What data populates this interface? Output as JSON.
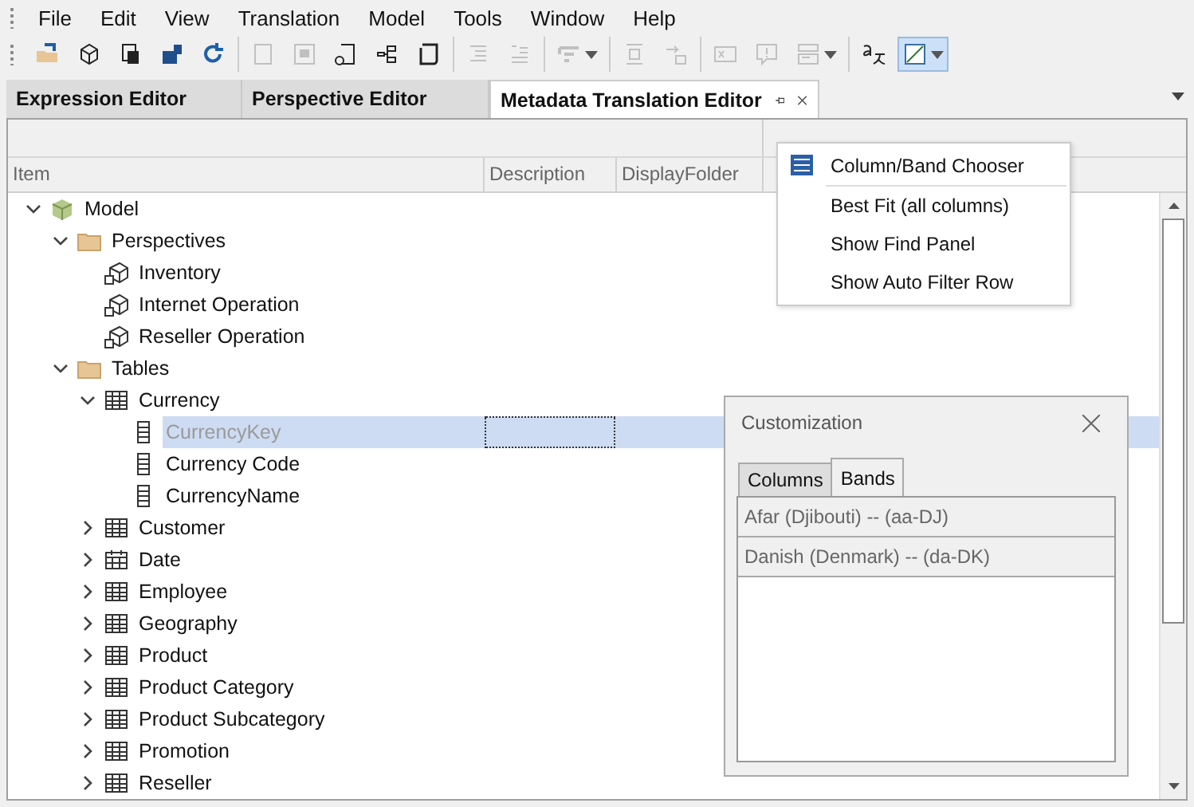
{
  "menu": [
    "File",
    "Edit",
    "View",
    "Translation",
    "Model",
    "Tools",
    "Window",
    "Help"
  ],
  "toolbar": [
    [
      {
        "disabled": false,
        "dropdown": false,
        "pressed": false
      },
      {
        "disabled": false,
        "dropdown": false,
        "pressed": false
      },
      {
        "disabled": false,
        "dropdown": false,
        "pressed": false
      },
      {
        "disabled": false,
        "dropdown": false,
        "pressed": false
      },
      {
        "disabled": false,
        "dropdown": false,
        "pressed": false
      }
    ],
    [
      {
        "disabled": true,
        "dropdown": false,
        "pressed": false
      },
      {
        "disabled": true,
        "dropdown": false,
        "pressed": false
      },
      {
        "disabled": false,
        "dropdown": false,
        "pressed": false
      },
      {
        "disabled": false,
        "dropdown": false,
        "pressed": false
      },
      {
        "disabled": false,
        "dropdown": false,
        "pressed": false
      }
    ],
    [
      {
        "disabled": true,
        "dropdown": false,
        "pressed": false
      },
      {
        "disabled": true,
        "dropdown": false,
        "pressed": false
      }
    ],
    [
      {
        "disabled": true,
        "dropdown": true,
        "pressed": false
      }
    ],
    [
      {
        "disabled": true,
        "dropdown": false,
        "pressed": false
      },
      {
        "disabled": true,
        "dropdown": false,
        "pressed": false
      }
    ],
    [
      {
        "disabled": true,
        "dropdown": false,
        "pressed": false
      },
      {
        "disabled": true,
        "dropdown": false,
        "pressed": false
      },
      {
        "disabled": true,
        "dropdown": true,
        "pressed": false
      }
    ],
    [
      {
        "disabled": false,
        "dropdown": false,
        "pressed": false
      },
      {
        "disabled": false,
        "dropdown": true,
        "pressed": true
      }
    ]
  ],
  "tabs": [
    {
      "label": "Expression Editor",
      "selected": false
    },
    {
      "label": "Perspective Editor",
      "selected": false
    },
    {
      "label": "Metadata Translation Editor",
      "selected": true
    }
  ],
  "grid": {
    "columns": [
      "Item",
      "Description",
      "DisplayFolder"
    ],
    "tree": [
      {
        "label": "Model",
        "kind": "model",
        "expanded": true,
        "selected": false,
        "children": [
          {
            "label": "Perspectives",
            "kind": "folder",
            "expanded": true,
            "selected": false,
            "children": [
              {
                "label": "Inventory",
                "kind": "perspective",
                "selected": false
              },
              {
                "label": "Internet Operation",
                "kind": "perspective",
                "selected": false
              },
              {
                "label": "Reseller Operation",
                "kind": "perspective",
                "selected": false
              }
            ]
          },
          {
            "label": "Tables",
            "kind": "folder",
            "expanded": true,
            "selected": false,
            "children": [
              {
                "label": "Currency",
                "kind": "table",
                "expanded": true,
                "selected": false,
                "children": [
                  {
                    "label": "CurrencyKey",
                    "kind": "column",
                    "selected": true
                  },
                  {
                    "label": "Currency Code",
                    "kind": "column",
                    "selected": false
                  },
                  {
                    "label": "CurrencyName",
                    "kind": "column",
                    "selected": false
                  }
                ]
              },
              {
                "label": "Customer",
                "kind": "table",
                "expanded": false,
                "selected": false
              },
              {
                "label": "Date",
                "kind": "date-table",
                "expanded": false,
                "selected": false
              },
              {
                "label": "Employee",
                "kind": "table",
                "expanded": false,
                "selected": false
              },
              {
                "label": "Geography",
                "kind": "table",
                "expanded": false,
                "selected": false
              },
              {
                "label": "Product",
                "kind": "table",
                "expanded": false,
                "selected": false
              },
              {
                "label": "Product Category",
                "kind": "table",
                "expanded": false,
                "selected": false
              },
              {
                "label": "Product Subcategory",
                "kind": "table",
                "expanded": false,
                "selected": false
              },
              {
                "label": "Promotion",
                "kind": "table",
                "expanded": false,
                "selected": false
              },
              {
                "label": "Reseller",
                "kind": "table",
                "expanded": false,
                "selected": false
              }
            ]
          }
        ]
      }
    ]
  },
  "context_menu": [
    {
      "label": "Column/Band Chooser",
      "kind": "icon"
    },
    {
      "label": "Best Fit (all columns)",
      "kind": "plain"
    },
    {
      "label": "Show Find Panel",
      "kind": "plain"
    },
    {
      "label": "Show Auto Filter Row",
      "kind": "plain"
    }
  ],
  "customization": {
    "title": "Customization",
    "tabs": [
      {
        "label": "Columns",
        "selected": false
      },
      {
        "label": "Bands",
        "selected": true
      }
    ],
    "bands": [
      "Afar (Djibouti) -- (aa-DJ)",
      "Danish (Denmark) -- (da-DK)"
    ]
  }
}
